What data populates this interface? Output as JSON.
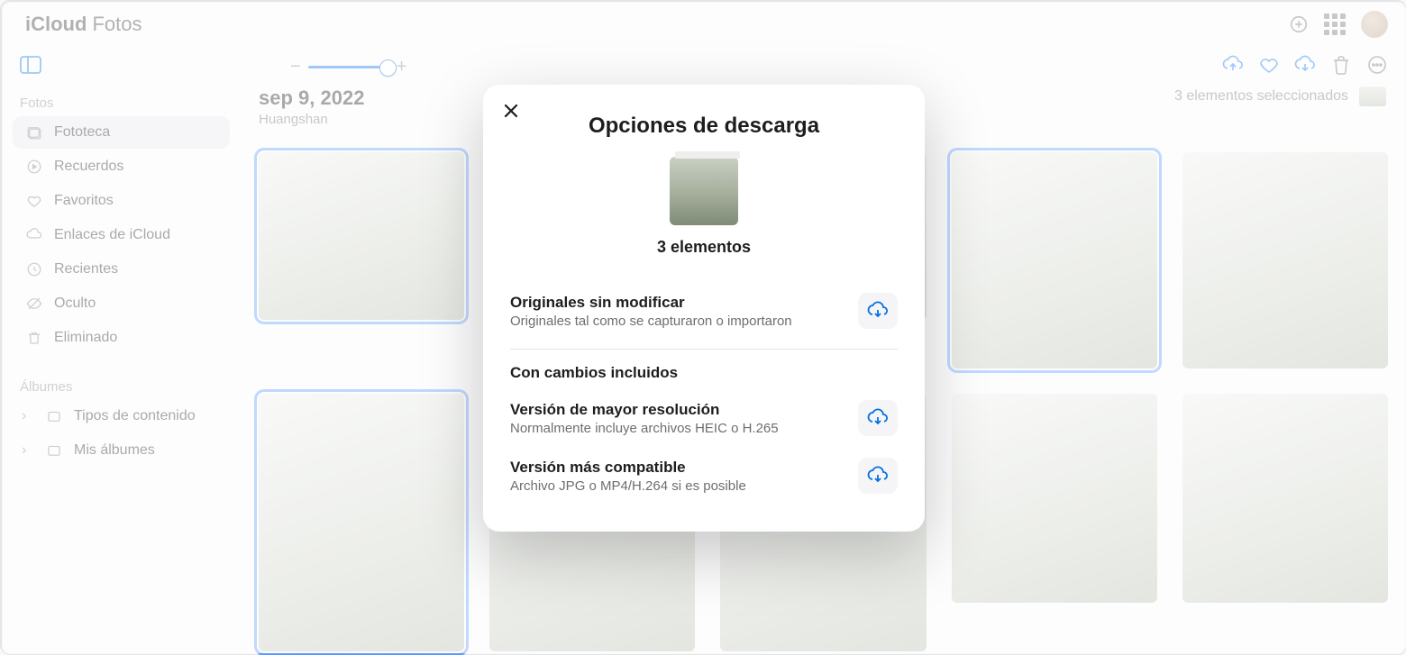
{
  "header": {
    "brand_main": "iCloud",
    "brand_app": "Fotos"
  },
  "sidebar": {
    "sections": [
      {
        "label": "Fotos",
        "items": [
          {
            "label": "Fototeca",
            "active": true,
            "icon": "library"
          },
          {
            "label": "Recuerdos",
            "icon": "play-circle"
          },
          {
            "label": "Favoritos",
            "icon": "heart"
          },
          {
            "label": "Enlaces de iCloud",
            "icon": "cloud-link"
          },
          {
            "label": "Recientes",
            "icon": "clock"
          },
          {
            "label": "Oculto",
            "icon": "eye-off"
          },
          {
            "label": "Eliminado",
            "icon": "trash"
          }
        ]
      },
      {
        "label": "Álbumes",
        "items": [
          {
            "label": "Tipos de contenido",
            "icon": "folder",
            "disclosure": true
          },
          {
            "label": "Mis álbumes",
            "icon": "folder",
            "disclosure": true
          }
        ]
      }
    ]
  },
  "main": {
    "date": "sep 9, 2022",
    "location": "Huangshan",
    "selection_text": "3 elementos seleccionados"
  },
  "modal": {
    "title": "Opciones de descarga",
    "count_label": "3 elementos",
    "opt1": {
      "title": "Originales sin modificar",
      "subtitle": "Originales tal como se capturaron o importaron"
    },
    "section2_label": "Con cambios incluidos",
    "opt2": {
      "title": "Versión de mayor resolución",
      "subtitle": "Normalmente incluye archivos HEIC o H.265"
    },
    "opt3": {
      "title": "Versión más compatible",
      "subtitle": "Archivo JPG o MP4/H.264 si es posible"
    }
  }
}
